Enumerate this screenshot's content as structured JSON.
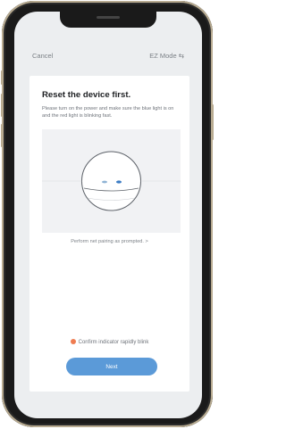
{
  "nav": {
    "cancel_label": "Cancel",
    "mode_label": "EZ Mode ⇆"
  },
  "content": {
    "title": "Reset the device first.",
    "description": "Please turn on the power and make sure the blue light is on and the red light is blinking fast.",
    "illustration_icon": "device-indicator-lights",
    "pairing_link": "Perform net pairing as prompted. >"
  },
  "footer": {
    "confirm_label": "Confirm indicator rapidly blink",
    "confirm_checked": false,
    "next_label": "Next"
  },
  "colors": {
    "accent": "#5b9ad8",
    "confirm_dot": "#ef7c51",
    "screen_bg": "#eceef0",
    "phone_frame": "#b8ab91",
    "indicator_left": "#8fb3d4",
    "indicator_right": "#3c7cc4"
  }
}
